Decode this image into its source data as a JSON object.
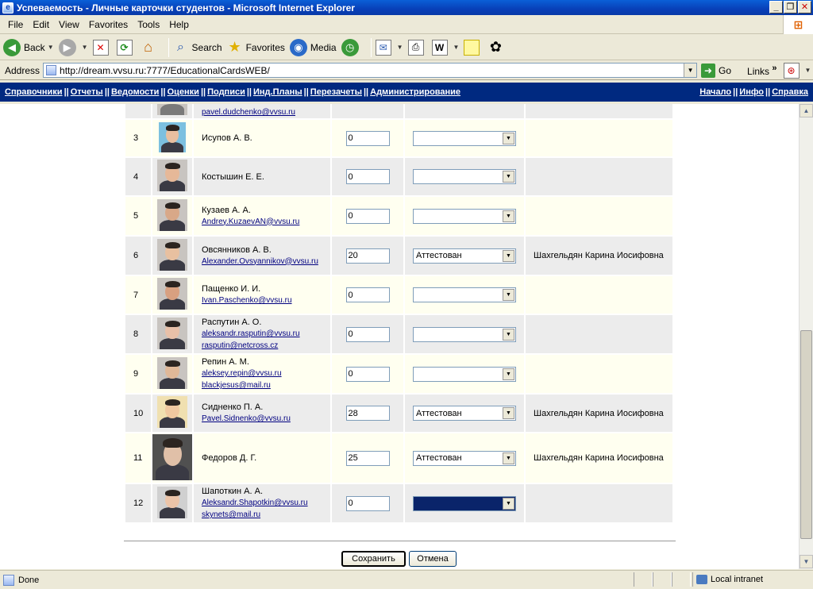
{
  "window": {
    "title": "Успеваемость - Личные карточки студентов - Microsoft Internet Explorer"
  },
  "menu": [
    "File",
    "Edit",
    "View",
    "Favorites",
    "Tools",
    "Help"
  ],
  "toolbar": {
    "back": "Back",
    "search": "Search",
    "favorites": "Favorites",
    "media": "Media"
  },
  "address": {
    "label": "Address",
    "url": "http://dream.vvsu.ru:7777/EducationalCardsWEB/",
    "go": "Go",
    "links": "Links",
    "links_chevron": "»"
  },
  "nav": {
    "left": [
      "Справочники",
      "Отчеты",
      "Ведомости",
      "Оценки",
      "Подписи",
      "Инд.Планы",
      "Перезачеты",
      "Администрирование"
    ],
    "right": [
      "Начало",
      "Инфо",
      "Справка"
    ],
    "separator": "||"
  },
  "partial_row": {
    "email": "pavel.dudchenko@vvsu.ru"
  },
  "students": [
    {
      "num": "3",
      "name": "Исупов А. В.",
      "emails": [],
      "score": "0",
      "status": "",
      "teacher": ""
    },
    {
      "num": "4",
      "name": "Костышин Е. Е.",
      "emails": [],
      "score": "0",
      "status": "",
      "teacher": ""
    },
    {
      "num": "5",
      "name": "Кузаев А. А.",
      "emails": [
        "Andrey.KuzaevAN@vvsu.ru"
      ],
      "score": "0",
      "status": "",
      "teacher": ""
    },
    {
      "num": "6",
      "name": "Овсянников А. В.",
      "emails": [
        "Alexander.Ovsyannikov@vvsu.ru"
      ],
      "score": "20",
      "status": "Аттестован",
      "teacher": "Шахгельдян Карина Иосифовна"
    },
    {
      "num": "7",
      "name": "Пащенко И. И.",
      "emails": [
        "Ivan.Paschenko@vvsu.ru"
      ],
      "score": "0",
      "status": "",
      "teacher": ""
    },
    {
      "num": "8",
      "name": "Распутин А. О.",
      "emails": [
        "aleksandr.rasputin@vvsu.ru",
        "rasputin@netcross.cz"
      ],
      "score": "0",
      "status": "",
      "teacher": ""
    },
    {
      "num": "9",
      "name": "Репин А. М.",
      "emails": [
        "aleksey.repin@vvsu.ru",
        "blackjesus@mail.ru"
      ],
      "score": "0",
      "status": "",
      "teacher": ""
    },
    {
      "num": "10",
      "name": "Сидненко П. А.",
      "emails": [
        "Pavel.Sidnenko@vvsu.ru"
      ],
      "score": "28",
      "status": "Аттестован",
      "teacher": "Шахгельдян Карина Иосифовна"
    },
    {
      "num": "11",
      "name": "Федоров Д. Г.",
      "emails": [],
      "score": "25",
      "status": "Аттестован",
      "teacher": "Шахгельдян Карина Иосифовна"
    },
    {
      "num": "12",
      "name": "Шапоткин А. А.",
      "emails": [
        "Aleksandr.Shapotkin@vvsu.ru",
        "skynets@mail.ru"
      ],
      "score": "0",
      "status": "",
      "teacher": ""
    }
  ],
  "buttons": {
    "save": "Сохранить",
    "cancel": "Отмена"
  },
  "status": {
    "text": "Done",
    "zone": "Local intranet"
  },
  "colors": {
    "nav_bg": "#002980",
    "row_odd": "#fffff0",
    "row_even": "#ececec",
    "link": "#000080"
  }
}
